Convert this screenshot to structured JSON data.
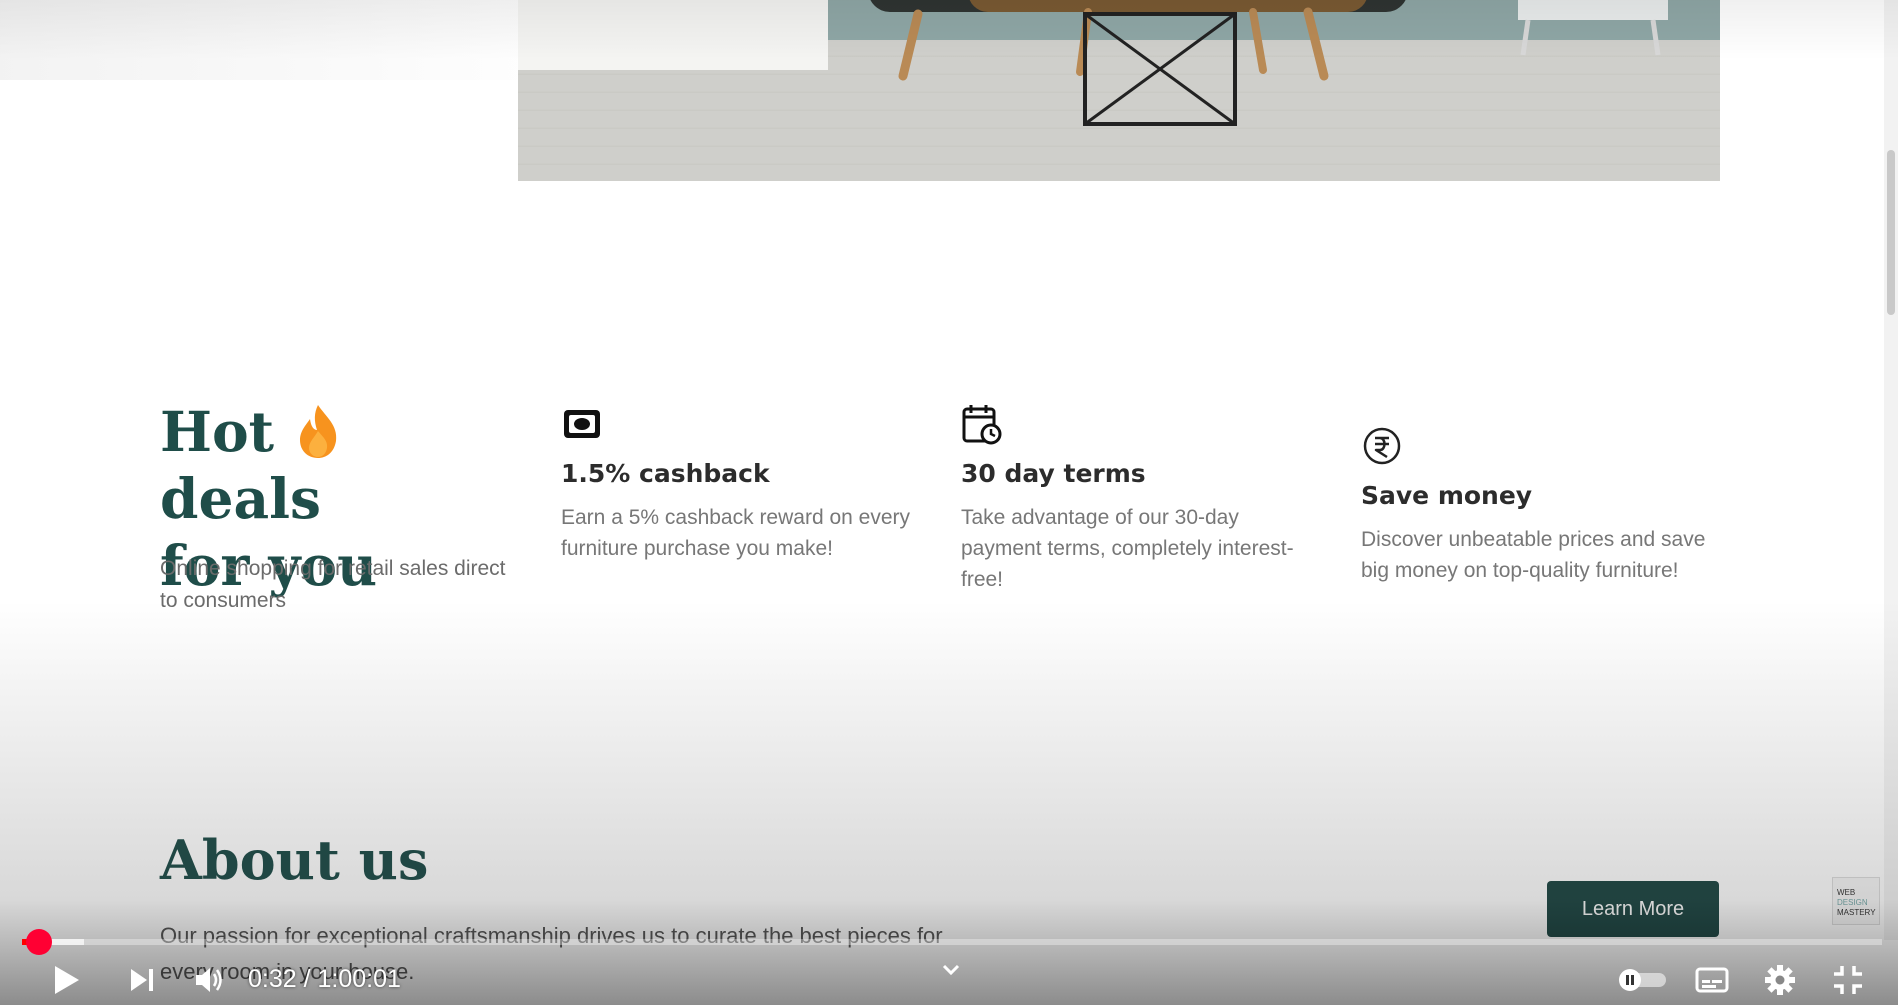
{
  "hot_deals": {
    "title_part1": "Hot",
    "title_part2": "deals",
    "title_line2": "for you",
    "subtitle": "Online shopping for retail sales direct to consumers"
  },
  "features": [
    {
      "icon": "cash-icon",
      "title": "1.5% cashback",
      "desc": "Earn a 5% cashback reward on every furniture purchase you make!"
    },
    {
      "icon": "calendar-clock-icon",
      "title": "30 day terms",
      "desc": "Take advantage of our 30-day payment terms, completely interest-free!"
    },
    {
      "icon": "rupee-icon",
      "title": "Save money",
      "desc": "Discover unbeatable prices and save big money on top-quality furniture!"
    }
  ],
  "about": {
    "title": "About us",
    "text": "Our passion for exceptional craftsmanship drives us to curate the best pieces for every room in your house.",
    "button": "Learn More"
  },
  "watermark": {
    "line1": "WEB",
    "line2": "DESIGN",
    "line3": "MASTERY"
  },
  "player": {
    "time": "0:32 / 1:00:01",
    "progress_fraction": 0.0089,
    "accent": "#ff0000"
  },
  "colors": {
    "heading": "#1f4d49",
    "button": "#1e4744"
  }
}
